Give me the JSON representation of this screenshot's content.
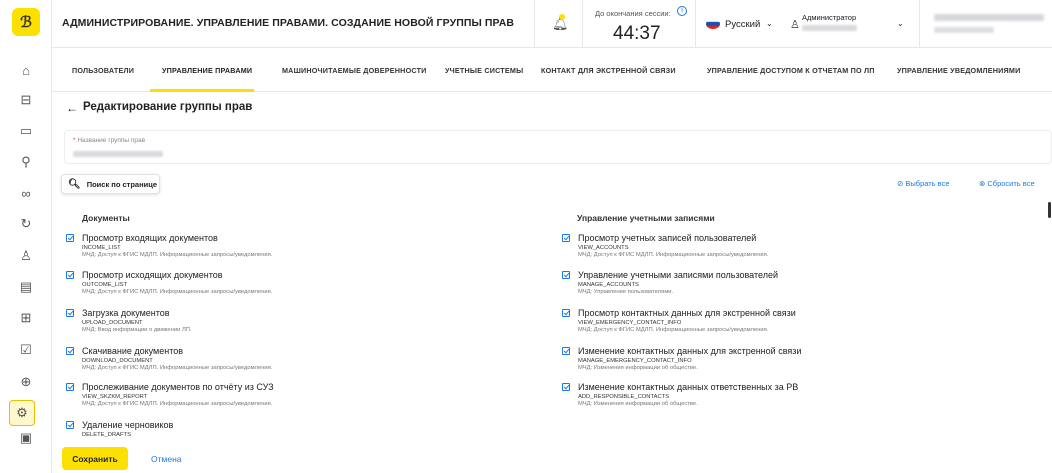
{
  "brand": {
    "logo_glyph": "ℬ",
    "accent": "#fce000",
    "link": "#1f7ae0"
  },
  "sidebar": {
    "items": [
      {
        "name": "home-icon",
        "glyph": "⌂"
      },
      {
        "name": "briefcase-icon",
        "glyph": "⊟"
      },
      {
        "name": "folder-icon",
        "glyph": "▭"
      },
      {
        "name": "pill-icon",
        "glyph": "⚲"
      },
      {
        "name": "link-icon",
        "glyph": "∞"
      },
      {
        "name": "history-icon",
        "glyph": "↻"
      },
      {
        "name": "user-icon",
        "glyph": "♙"
      },
      {
        "name": "document-icon",
        "glyph": "▤"
      },
      {
        "name": "grid-icon",
        "glyph": "⊞"
      },
      {
        "name": "check-square-icon",
        "glyph": "☑"
      },
      {
        "name": "globe-icon",
        "glyph": "⊕"
      },
      {
        "name": "settings-icon",
        "glyph": "⚙"
      },
      {
        "name": "report-icon",
        "glyph": "▣"
      }
    ]
  },
  "header": {
    "title": "АДМИНИСТРИРОВАНИЕ. УПРАВЛЕНИЕ ПРАВАМИ. СОЗДАНИЕ НОВОЙ ГРУППЫ ПРАВ",
    "session_label": "До окончания сессии:",
    "session_info": "i",
    "session_time": "44:37",
    "language": "Русский",
    "user_role": "Администратор"
  },
  "tabs": [
    {
      "label": "ПОЛЬЗОВАТЕЛИ",
      "name": "tab-users"
    },
    {
      "label": "УПРАВЛЕНИЕ ПРАВАМИ",
      "name": "tab-rights",
      "active": true
    },
    {
      "label": "МАШИНОЧИТАЕМЫЕ ДОВЕРЕННОСТИ",
      "name": "tab-machine-readable-poa"
    },
    {
      "label": "УЧЕТНЫЕ СИСТЕМЫ",
      "name": "tab-accounting-systems"
    },
    {
      "label": "КОНТАКТ ДЛЯ ЭКСТРЕННОЙ СВЯЗИ",
      "name": "tab-emergency-contact"
    },
    {
      "label": "УПРАВЛЕНИЕ ДОСТУПОМ К ОТЧЕТАМ ПО ЛП",
      "name": "tab-report-access"
    },
    {
      "label": "УПРАВЛЕНИЕ УВЕДОМЛЕНИЯМИ",
      "name": "tab-notifications"
    }
  ],
  "form": {
    "title": "Редактирование группы прав",
    "field_label_required": "*",
    "field_label": "Название группы прав",
    "search_label": "Поиск по странице",
    "select_all": "Выбрать все",
    "reset_all": "Сбросить все",
    "save": "Сохранить",
    "cancel": "Отмена"
  },
  "groups": {
    "documents": {
      "title": "Документы",
      "items": [
        {
          "title": "Просмотр входящих документов",
          "code": "INCOME_LIST",
          "desc": "МЧД: Доступ к ФГИС МДЛП. Информационные запросы/уведомления."
        },
        {
          "title": "Просмотр исходящих документов",
          "code": "OUTCOME_LIST",
          "desc": "МЧД: Доступ к ФГИС МДЛП. Информационные запросы/уведомления."
        },
        {
          "title": "Загрузка документов",
          "code": "UPLOAD_DOCUMENT",
          "desc": "МЧД: Ввод информации о движении ЛП."
        },
        {
          "title": "Скачивание документов",
          "code": "DOWNLOAD_DOCUMENT",
          "desc": "МЧД: Доступ к ФГИС МДЛП. Информационные запросы/уведомления."
        },
        {
          "title": "Прослеживание документов по отчёту из СУЗ",
          "code": "VIEW_SKZKM_REPORT",
          "desc": "МЧД: Доступ к ФГИС МДЛП. Информационные запросы/уведомления."
        },
        {
          "title": "Удаление черновиков",
          "code": "DELETE_DRAFTS",
          "desc": ""
        }
      ]
    },
    "accounts": {
      "title": "Управление учетными записями",
      "items": [
        {
          "title": "Просмотр учетных записей пользователей",
          "code": "VIEW_ACCOUNTS",
          "desc": "МЧД: Доступ к ФГИС МДЛП. Информационные запросы/уведомления."
        },
        {
          "title": "Управление учетными записями пользователей",
          "code": "MANAGE_ACCOUNTS",
          "desc": "МЧД: Управление пользователями."
        },
        {
          "title": "Просмотр контактных данных для экстренной связи",
          "code": "VIEW_EMERGENCY_CONTACT_INFO",
          "desc": "МЧД: Доступ к ФГИС МДЛП. Информационные запросы/уведомления."
        },
        {
          "title": "Изменение контактных данных для экстренной связи",
          "code": "MANAGE_EMERGENCY_CONTACT_INFO",
          "desc": "МЧД: Изменения информации об обществе."
        },
        {
          "title": "Изменение контактных данных ответственных за РВ",
          "code": "ADD_RESPONSIBLE_CONTACTS",
          "desc": "МЧД: Изменения информации об обществе."
        }
      ]
    }
  }
}
